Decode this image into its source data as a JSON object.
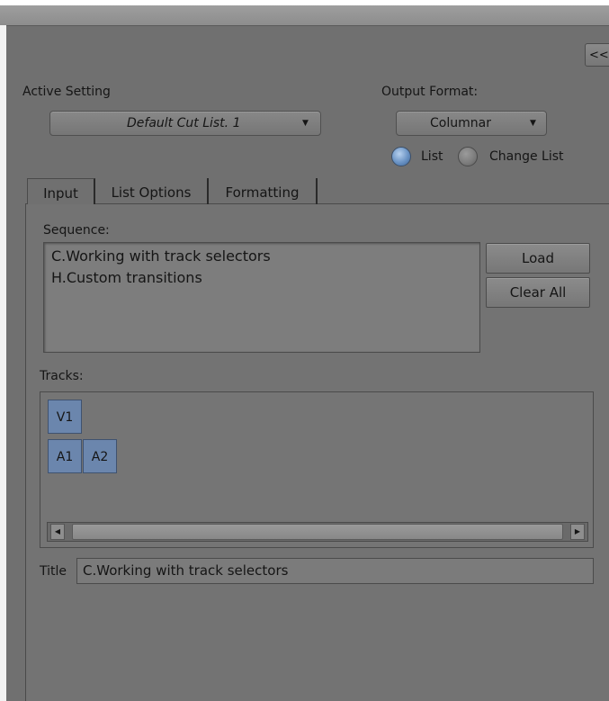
{
  "collapse_label": "<<",
  "active_setting": {
    "label": "Active Setting",
    "value": "Default Cut List. 1"
  },
  "output_format": {
    "label": "Output Format:",
    "value": "Columnar",
    "radio_options": [
      {
        "label": "List",
        "selected": true
      },
      {
        "label": "Change List",
        "selected": false
      }
    ]
  },
  "tabs": [
    {
      "label": "Input",
      "active": true
    },
    {
      "label": "List Options",
      "active": false
    },
    {
      "label": "Formatting",
      "active": false
    }
  ],
  "sequence": {
    "label": "Sequence:",
    "items": [
      "C.Working with track selectors",
      "H.Custom transitions"
    ],
    "load_label": "Load",
    "clear_label": "Clear All"
  },
  "tracks": {
    "label": "Tracks:",
    "video": [
      "V1"
    ],
    "audio": [
      "A1",
      "A2"
    ]
  },
  "title_field": {
    "label": "Title",
    "value": "C.Working with track selectors"
  },
  "colors": {
    "panel_bg": "#707070",
    "track_button": "#6b86ad",
    "radio_selected": "#6a93c4"
  }
}
